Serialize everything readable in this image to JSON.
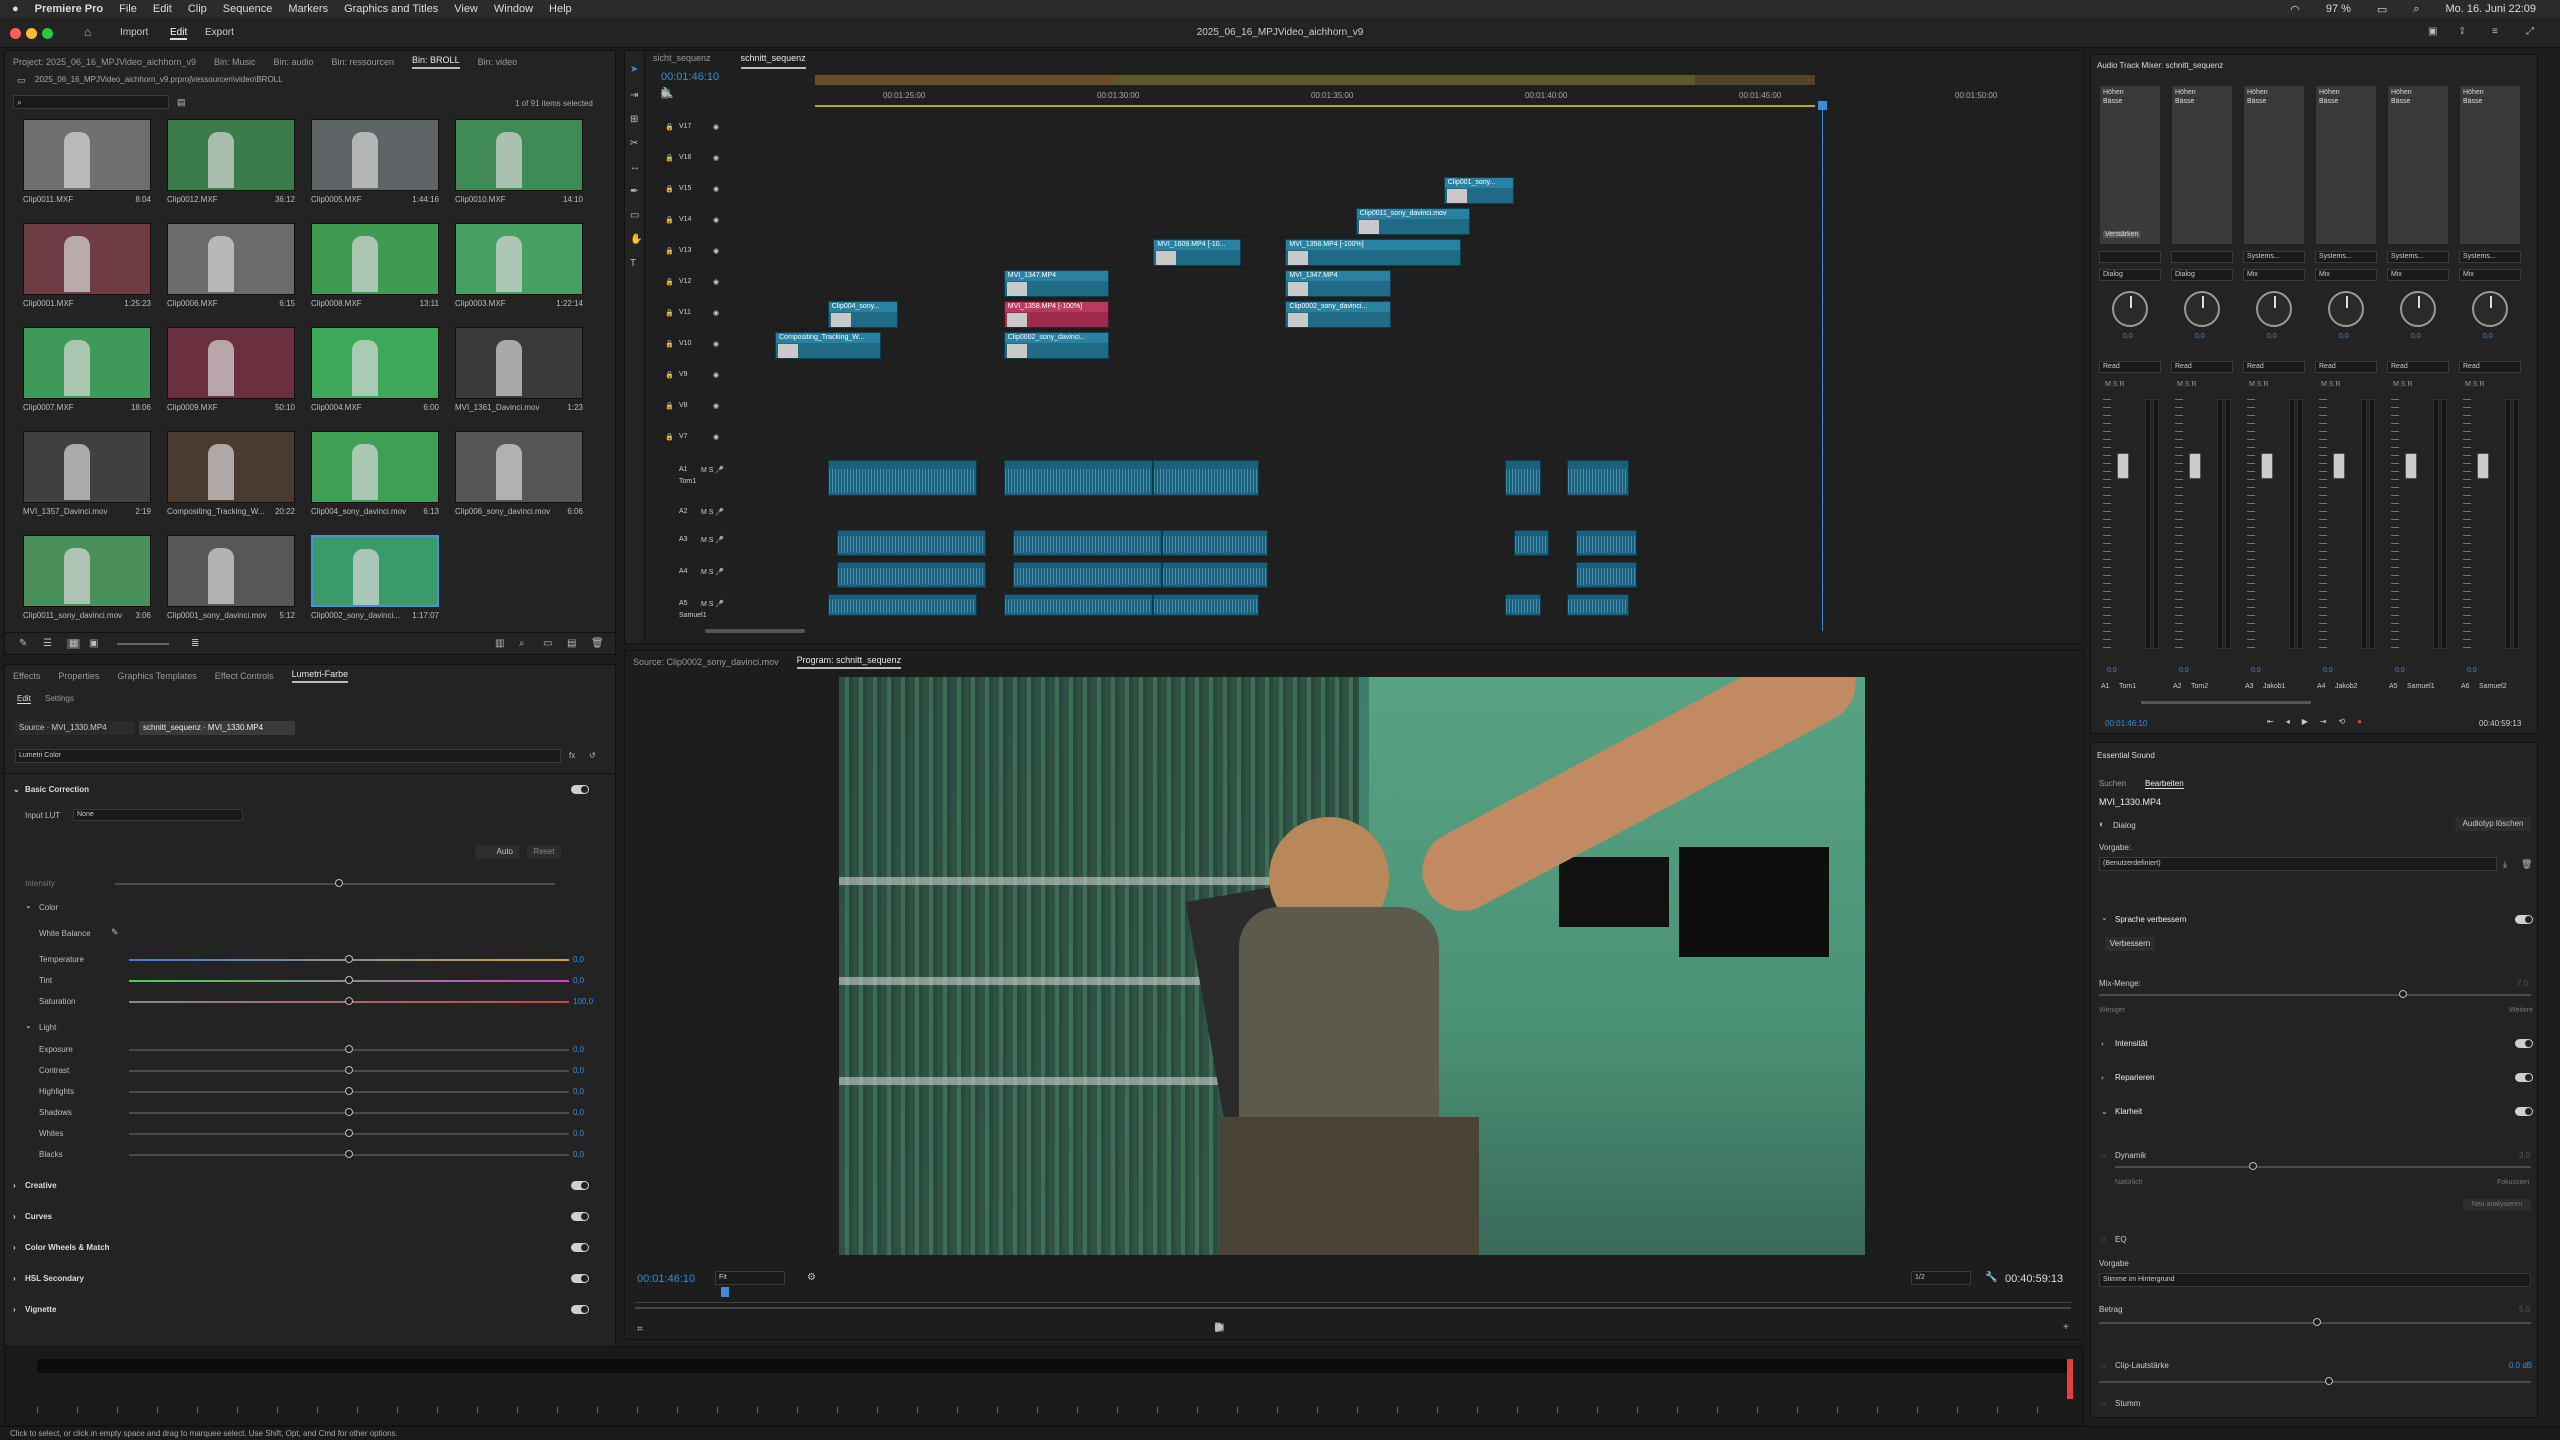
{
  "macmenu": {
    "apple": "",
    "app": "Premiere Pro",
    "items": [
      "File",
      "Edit",
      "Clip",
      "Sequence",
      "Markers",
      "Graphics and Titles",
      "View",
      "Window",
      "Help"
    ],
    "battery": "97 %",
    "datetime": "Mo. 16. Juni 22:09"
  },
  "window": {
    "title": "2025_06_16_MPJVideo_aichhorn_v9",
    "workspace_tabs": [
      "Import",
      "Edit",
      "Export"
    ]
  },
  "project": {
    "tabs": [
      "Project: 2025_06_16_MPJVideo_aichhorn_v9",
      "Bin: Music",
      "Bin: audio",
      "Bin: ressourcen",
      "Bin: BROLL",
      "Bin: video"
    ],
    "path": "2025_06_16_MPJVideo_aichhorn_v9.prproj\\ressourcen\\video\\BROLL",
    "search_placeholder": "",
    "count": "1 of 91 items selected",
    "clips": [
      {
        "name": "Clip0011.MXF",
        "dur": "8:04",
        "bg": "#6f6f6f"
      },
      {
        "name": "Clip0012.MXF",
        "dur": "36:12",
        "bg": "#3b7c4a"
      },
      {
        "name": "Clip0005.MXF",
        "dur": "1:44:16",
        "bg": "#5f6466"
      },
      {
        "name": "Clip0010.MXF",
        "dur": "14:10",
        "bg": "#3f8a55"
      },
      {
        "name": "Clip0001.MXF",
        "dur": "1:25:23",
        "bg": "#6e3c45"
      },
      {
        "name": "Clip0006.MXF",
        "dur": "6:15",
        "bg": "#6a6c6a"
      },
      {
        "name": "Clip0008.MXF",
        "dur": "13:11",
        "bg": "#3f9b52"
      },
      {
        "name": "Clip0003.MXF",
        "dur": "1:22:14",
        "bg": "#45a062"
      },
      {
        "name": "Clip0007.MXF",
        "dur": "18:06",
        "bg": "#3f9a5a"
      },
      {
        "name": "Clip0009.MXF",
        "dur": "50:10",
        "bg": "#6b3040"
      },
      {
        "name": "Clip0004.MXF",
        "dur": "6:00",
        "bg": "#3ba85a"
      },
      {
        "name": "MVI_1361_Davinci.mov",
        "dur": "1:23",
        "bg": "#3a3a3a"
      },
      {
        "name": "MVI_1357_Davinci.mov",
        "dur": "2:19",
        "bg": "#404040"
      },
      {
        "name": "Compositing_Tracking_W...",
        "dur": "20:22",
        "bg": "#4a3a30"
      },
      {
        "name": "Clip004_sony_davinci.mov",
        "dur": "6:13",
        "bg": "#3fa055"
      },
      {
        "name": "Clip006_sony_davinci.mov",
        "dur": "6:06",
        "bg": "#555"
      },
      {
        "name": "Clip0011_sony_davinci.mov",
        "dur": "3:06",
        "bg": "#4a8f5a"
      },
      {
        "name": "Clip0001_sony_davinci.mov",
        "dur": "5:12",
        "bg": "#575757"
      },
      {
        "name": "Clip0002_sony_davinci...",
        "dur": "1:17:07",
        "bg": "#3a9a6a"
      }
    ]
  },
  "effects": {
    "tabs": [
      "Effects",
      "Properties",
      "Graphics Templates",
      "Effect Controls",
      "Lumetri-Farbe"
    ],
    "subtabs": [
      "Edit",
      "Settings"
    ],
    "source_btn": "Source · MVI_1330.MP4",
    "seq_btn": "schnitt_sequenz · MVI_1330.MP4",
    "effect": "Lumetri Color",
    "basic": "Basic Correction",
    "lut_label": "Input LUT",
    "lut_value": "None",
    "auto": "Auto",
    "reset": "Reset",
    "intensity": "Intensity",
    "color": "Color",
    "wb": "White Balance",
    "light": "Light",
    "sliders": [
      {
        "name": "Temperature",
        "value": "0,0",
        "pos": 0.5
      },
      {
        "name": "Tint",
        "value": "0,0",
        "pos": 0.5
      },
      {
        "name": "Saturation",
        "value": "100,0",
        "pos": 0.5
      }
    ],
    "light_sliders": [
      {
        "name": "Exposure",
        "value": "0,0",
        "pos": 0.5
      },
      {
        "name": "Contrast",
        "value": "0,0",
        "pos": 0.5
      },
      {
        "name": "Highlights",
        "value": "0,0",
        "pos": 0.5
      },
      {
        "name": "Shadows",
        "value": "0,0",
        "pos": 0.5
      },
      {
        "name": "Whites",
        "value": "0,0",
        "pos": 0.5
      },
      {
        "name": "Blacks",
        "value": "0,0",
        "pos": 0.5
      }
    ],
    "sections": [
      "Creative",
      "Curves",
      "Color Wheels & Match",
      "HSL Secondary",
      "Vignette"
    ]
  },
  "timeline": {
    "tabs": [
      "sicht_sequenz",
      "schnitt_sequenz"
    ],
    "timecode": "00:01:46:10",
    "ruler": [
      "00:01:25:00",
      "00:01:30:00",
      "00:01:35:00",
      "00:01:40:00",
      "00:01:45:00",
      "00:01:50:00"
    ],
    "vtracks": [
      "V17",
      "V16",
      "V15",
      "V14",
      "V13",
      "V12",
      "V11",
      "V10",
      "V9",
      "V8",
      "V7"
    ],
    "atracks": [
      {
        "id": "A1",
        "name": "Tom1"
      },
      {
        "id": "A2",
        "name": ""
      },
      {
        "id": "A3",
        "name": ""
      },
      {
        "id": "A4",
        "name": ""
      },
      {
        "id": "A5",
        "name": "Samuel1"
      }
    ],
    "clips": [
      {
        "label": "Clip001_sony...",
        "row": 2,
        "start": 0.76,
        "len": 0.08,
        "kind": "v"
      },
      {
        "label": "Clip0011_sony_davinci.mov",
        "row": 3,
        "start": 0.66,
        "len": 0.13,
        "kind": "v"
      },
      {
        "label": "MVI_1609.MP4 [-10...",
        "row": 4,
        "start": 0.43,
        "len": 0.1,
        "kind": "v"
      },
      {
        "label": "MVI_1358.MP4 [-100%]",
        "row": 4,
        "start": 0.58,
        "len": 0.2,
        "kind": "v"
      },
      {
        "label": "MVI_1347.MP4",
        "row": 5,
        "start": 0.26,
        "len": 0.12,
        "kind": "v"
      },
      {
        "label": "MVI_1347.MP4",
        "row": 5,
        "start": 0.58,
        "len": 0.12,
        "kind": "v"
      },
      {
        "label": "Clip004_sony...",
        "row": 6,
        "start": 0.06,
        "len": 0.08,
        "kind": "v"
      },
      {
        "label": "MVI_1358.MP4 [-100%]",
        "row": 6,
        "start": 0.26,
        "len": 0.12,
        "kind": "r"
      },
      {
        "label": "Clip0002_sony_davinci...",
        "row": 6,
        "start": 0.58,
        "len": 0.12,
        "kind": "v"
      },
      {
        "label": "Compositing_Tracking_W...",
        "row": 7,
        "start": 0.0,
        "len": 0.12,
        "kind": "v"
      },
      {
        "label": "Clip0002_sony_davinci...",
        "row": 7,
        "start": 0.26,
        "len": 0.12,
        "kind": "v"
      }
    ]
  },
  "program": {
    "tabs": [
      "Source: Clip0002_sony_davinci.mov",
      "Program: schnitt_sequenz"
    ],
    "timecode": "00:01:46:10",
    "fit": "Fit",
    "quality": "1/2",
    "duration": "00:40:59:13",
    "playhead": 0.06
  },
  "mixer": {
    "title": "Audio Track Mixer: schnitt_sequenz",
    "tracks": [
      {
        "id": "A1",
        "name": "Tom1",
        "send": "Dialog",
        "mode": "Read",
        "val": "0,0"
      },
      {
        "id": "A2",
        "name": "Tom2",
        "send": "Dialog",
        "mode": "Read",
        "val": "0,0"
      },
      {
        "id": "A3",
        "name": "Jakob1",
        "send": "Mix",
        "mode": "Read",
        "val": "0,0"
      },
      {
        "id": "A4",
        "name": "Jakob2",
        "send": "Mix",
        "mode": "Read",
        "val": "0,0"
      },
      {
        "id": "A5",
        "name": "Samuel1",
        "send": "Mix",
        "mode": "Read",
        "val": "0,0"
      },
      {
        "id": "A6",
        "name": "Samuel2",
        "send": "Mix",
        "mode": "Read",
        "val": "0,0"
      }
    ],
    "fx": [
      "Höhen Bässe",
      "Höhen Bässe",
      "Höhen Bässe",
      "Höhen Bässe",
      "Höhen Bässe",
      "Höhen Bässe"
    ],
    "enhance": "Verstärken",
    "systems": "Systems...",
    "timecode": "00:01:46:10",
    "duration": "00:40:59:13"
  },
  "essential": {
    "title": "Essential Sound",
    "tabs": [
      "Suchen",
      "Bearbeiten"
    ],
    "clip": "MVI_1330.MP4",
    "type": "Dialog",
    "clear": "Audiotyp löschen",
    "preset_label": "Vorgabe:",
    "preset": "(Benutzerdefiniert)",
    "speech": "Sprache verbessern",
    "improve": "Verbessern",
    "mix": "Mix-Menge:",
    "mix_val": "7,0",
    "less": "Weniger",
    "more": "Weitere",
    "rows": [
      "Intensität",
      "Reparieren",
      "Klarheit"
    ],
    "dynamics": "Dynamik",
    "dyn_val": "3,0",
    "natural": "Natürlich",
    "focused": "Fokussiert",
    "analyze": "Neu analysieren",
    "eq": "EQ",
    "vorgabe": "Vorgabe",
    "vorgabe_val": "Stimme im Hintergrund",
    "amount": "Betrag",
    "amount_val": "5,0",
    "loud": "Clip-Lautstärke",
    "loud_val": "0,0 dB",
    "mute": "Stumm"
  },
  "status": "Click to select, or click in empty space and drag to marquee select. Use Shift, Opt, and Cmd for other options."
}
